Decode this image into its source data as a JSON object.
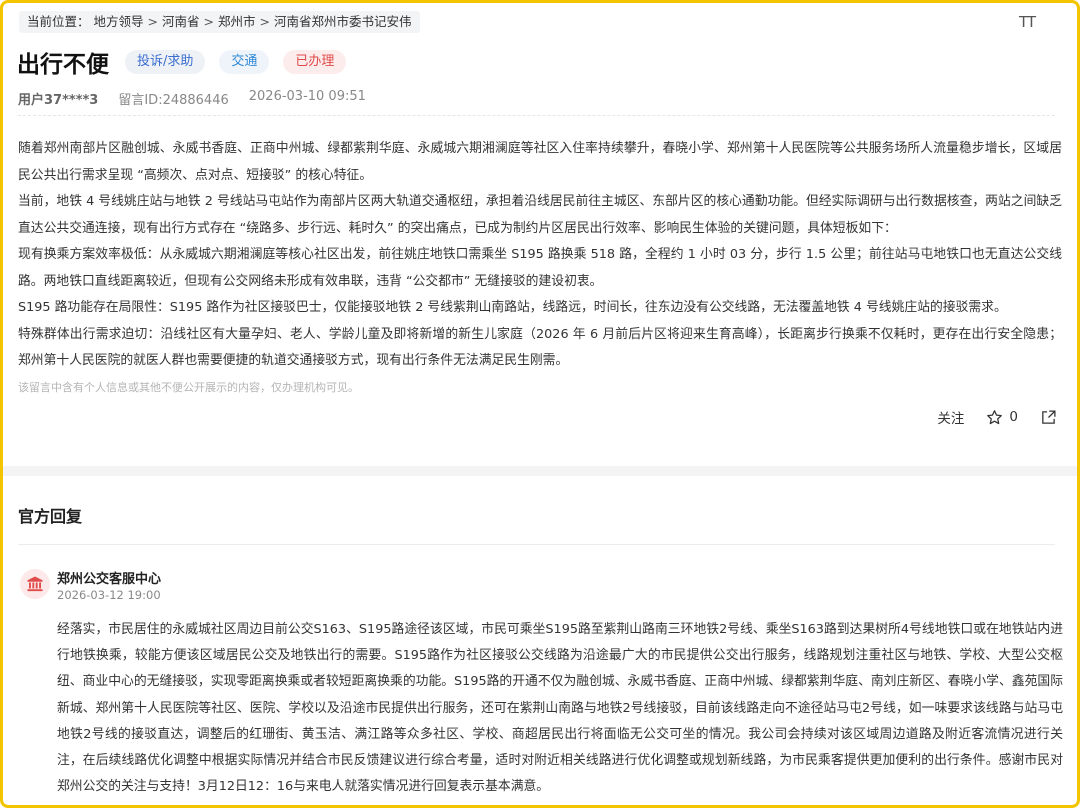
{
  "breadcrumb": {
    "prefix": "当前位置：",
    "items": [
      "地方领导",
      "河南省",
      "郑州市",
      "河南省郑州市委书记安伟"
    ],
    "separator": ">"
  },
  "font_toggle": "TT",
  "post": {
    "title": "出行不便",
    "tags": {
      "type": "投诉/求助",
      "domain": "交通",
      "status": "已办理"
    },
    "tag_colors": {
      "type": "#3b6ed0",
      "domain": "#2f88d6",
      "status": "#e04b4b"
    },
    "user": "用户37****3",
    "message_id": "留言ID:24886446",
    "datetime": "2026-03-10 09:51",
    "paragraphs": [
      "随着郑州南部片区融创城、永威书香庭、正商中州城、绿都紫荆华庭、永威城六期湘澜庭等社区入住率持续攀升，春晓小学、郑州第十人民医院等公共服务场所人流量稳步增长，区域居民公共出行需求呈现 “高频次、点对点、短接驳” 的核心特征。",
      "当前，地铁 4 号线姚庄站与地铁 2 号线站马屯站作为南部片区两大轨道交通枢纽，承担着沿线居民前往主城区、东部片区的核心通勤功能。但经实际调研与出行数据核查，两站之间缺乏直达公共交通连接，现有出行方式存在 “绕路多、步行远、耗时久” 的突出痛点，已成为制约片区居民出行效率、影响民生体验的关键问题，具体短板如下：",
      "现有换乘方案效率极低：从永威城六期湘澜庭等核心社区出发，前往姚庄地铁口需乘坐 S195 路换乘 518 路，全程约 1 小时 03 分，步行 1.5 公里；前往站马屯地铁口也无直达公交线路。两地铁口直线距离较近，但现有公交网络未形成有效串联，违背 “公交都市” 无缝接驳的建设初衷。",
      "S195 路功能存在局限性：S195 路作为社区接驳巴士，仅能接驳地铁 2 号线紫荆山南路站，线路远，时间长，往东边没有公交线路，无法覆盖地铁 4 号线姚庄站的接驳需求。",
      "特殊群体出行需求迫切：沿线社区有大量孕妇、老人、学龄儿童及即将新增的新生儿家庭（2026 年 6 月前后片区将迎来生育高峰），长距离步行换乘不仅耗时，更存在出行安全隐患；郑州第十人民医院的就医人群也需要便捷的轨道交通接驳方式，现有出行条件无法满足民生刚需。"
    ],
    "privacy_note": "该留言中含有个人信息或其他不便公开展示的内容，仅办理机构可见。",
    "actions": {
      "follow": "关注",
      "star_count": "0"
    }
  },
  "reply": {
    "section_title": "官方回复",
    "replier": "郑州公交客服中心",
    "datetime": "2026-03-12 19:00",
    "text": "经落实，市民居住的永威城社区周边目前公交S163、S195路途径该区域，市民可乘坐S195路至紫荆山路南三环地铁2号线、乘坐S163路到达果树所4号线地铁口或在地铁站内进行地铁换乘，较能方便该区域居民公交及地铁出行的需要。S195路作为社区接驳公交线路为沿途最广大的市民提供公交出行服务，线路规划注重社区与地铁、学校、大型公交枢纽、商业中心的无缝接驳，实现零距离换乘或者较短距离换乘的功能。S195路的开通不仅为融创城、永威书香庭、正商中州城、绿都紫荆华庭、南刘庄新区、春晓小学、鑫苑国际新城、郑州第十人民医院等社区、医院、学校以及沿途市民提供出行服务，还可在紫荆山南路与地铁2号线接驳，目前该线路走向不途径站马屯2号线，如一味要求该线路与站马屯地铁2号线的接驳直达，调整后的红珊街、黄玉洁、满江路等众多社区、学校、商超居民出行将面临无公交可坐的情况。我公司会持续对该区域周边道路及附近客流情况进行关注，在后续线路优化调整中根据实际情况并结合市民反馈建议进行综合考量，适时对附近相关线路进行优化调整或规划新线路，为市民乘客提供更加便利的出行条件。感谢市民对郑州公交的关注与支持！3月12日12：16与来电人就落实情况进行回复表示基本满意。"
  },
  "colors": {
    "frame": "#f5c400",
    "reply_icon": "#e04b4b"
  }
}
